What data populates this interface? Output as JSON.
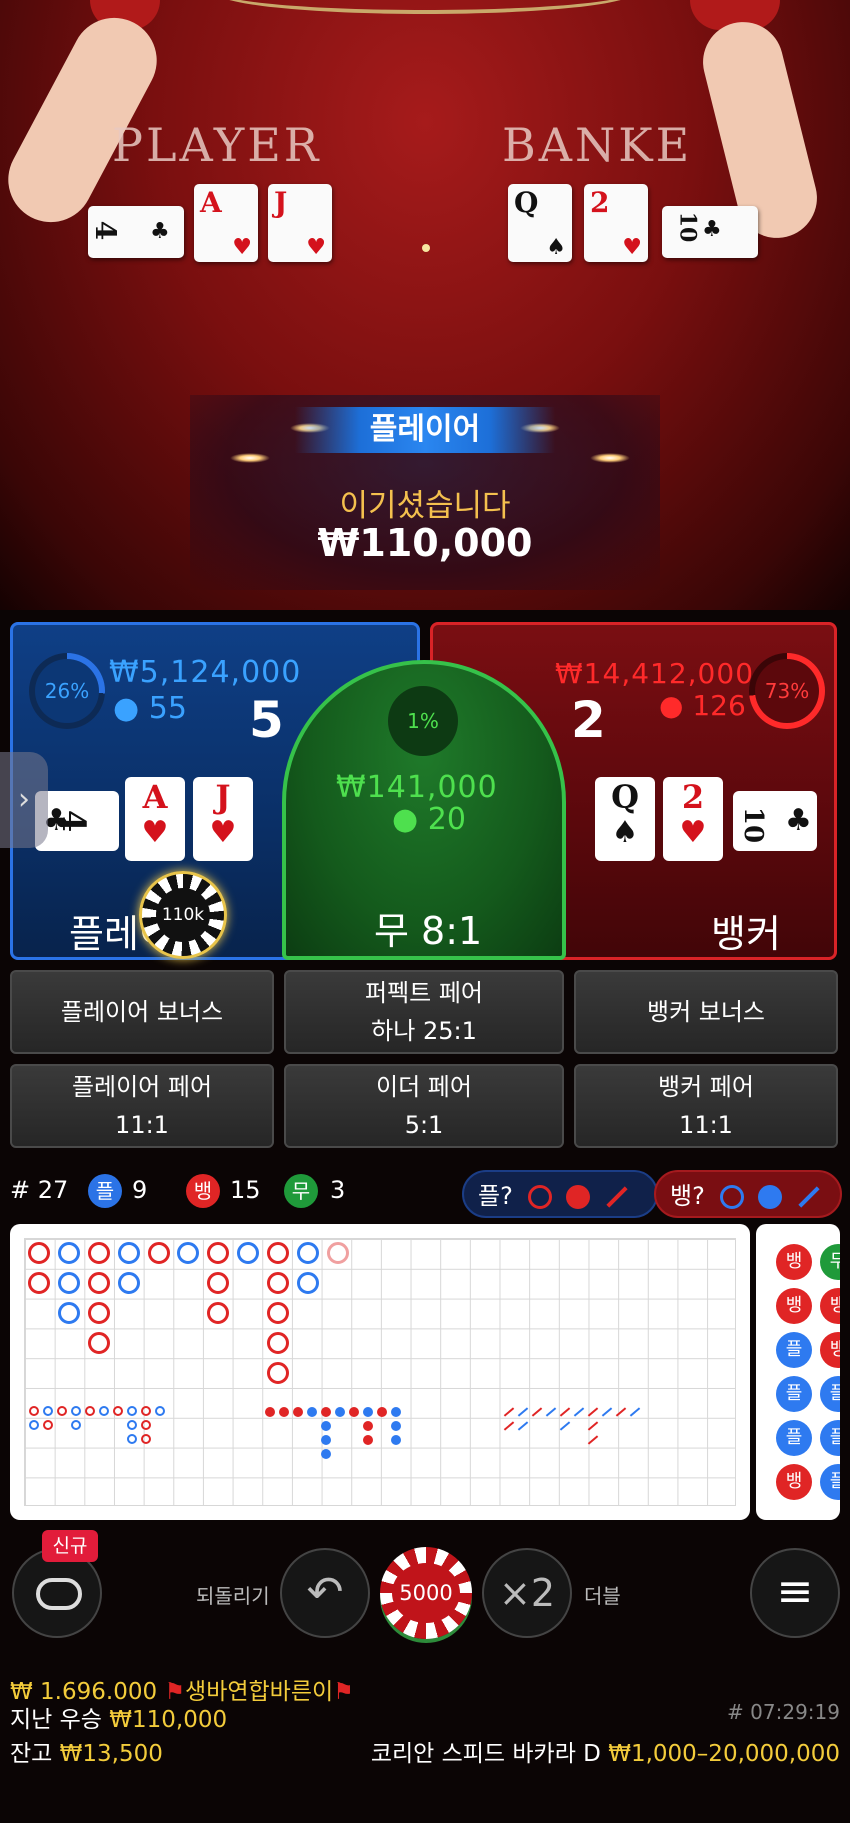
{
  "video": {
    "player_word": "PLAYER",
    "banker_word": "BANKE",
    "player_cards": [
      {
        "rank": "4",
        "suit": "♣",
        "color": "#111111"
      },
      {
        "rank": "A",
        "suit": "♥",
        "color": "#d4121c"
      },
      {
        "rank": "J",
        "suit": "♥",
        "color": "#d4121c"
      }
    ],
    "banker_cards": [
      {
        "rank": "Q",
        "suit": "♠",
        "color": "#111111"
      },
      {
        "rank": "2",
        "suit": "♥",
        "color": "#d4121c"
      },
      {
        "rank": "10",
        "suit": "♣",
        "color": "#111111"
      }
    ]
  },
  "win_banner": {
    "title": "플레이어",
    "message": "이기셨습니다",
    "amount": "₩110,000"
  },
  "player_spot": {
    "percent": "26%",
    "total": "₩5,124,000",
    "players": "55",
    "score": "5",
    "label": "플레이어",
    "chip": "110k",
    "cards": [
      {
        "rank": "4",
        "suit": "♣"
      },
      {
        "rank": "A",
        "suit": "♥"
      },
      {
        "rank": "J",
        "suit": "♥"
      }
    ]
  },
  "tie_spot": {
    "percent": "1%",
    "total": "₩141,000",
    "players": "20",
    "label": "무 8:1"
  },
  "banker_spot": {
    "percent": "73%",
    "total": "₩14,412,000",
    "players": "126",
    "score": "2",
    "label": "뱅커",
    "cards": [
      {
        "rank": "Q",
        "suit": "♠"
      },
      {
        "rank": "2",
        "suit": "♥"
      },
      {
        "rank": "10",
        "suit": "♣"
      }
    ]
  },
  "side_bets": {
    "player_bonus": "플레이어 보너스",
    "perfect_pair_1": "퍼펙트 페어",
    "perfect_pair_2": "하나 25:1",
    "banker_bonus": "뱅커 보너스",
    "player_pair_1": "플레이어 페어",
    "player_pair_2": "11:1",
    "either_pair_1": "이더 페어",
    "either_pair_2": "5:1",
    "banker_pair_1": "뱅커 페어",
    "banker_pair_2": "11:1"
  },
  "stats": {
    "round_label": "# 27",
    "player_badge": "플",
    "player_count": "9",
    "banker_badge": "뱅",
    "banker_count": "15",
    "tie_badge": "무",
    "tie_count": "3",
    "player_predict": "플?",
    "banker_predict": "뱅?"
  },
  "bead_road": [
    "뱅",
    "뱅",
    "플",
    "플",
    "플",
    "뱅"
  ],
  "bead_road_partial": [
    "무",
    "뱅",
    "뱅",
    "플",
    "플",
    "플"
  ],
  "controls": {
    "new_badge": "신규",
    "undo_label": "되돌리기",
    "chip_value": "5000",
    "double_symbol": "×2",
    "double_label": "더블"
  },
  "footer": {
    "jackpot_amount": "₩ 1.696.000",
    "jackpot_user": "생바연합바른이",
    "last_win_label": "지난 우승",
    "last_win_amount": "₩110,000",
    "round_id": "# 07:29:19",
    "balance_label": "잔고",
    "balance_amount": "₩13,500",
    "table_name": "코리안 스피드 바카라 D",
    "limits": "₩1,000–20,000,000"
  },
  "colors": {
    "player": "#2b73e6",
    "banker": "#d92327",
    "tie": "#36c24a",
    "gold": "#f3cc3b"
  }
}
